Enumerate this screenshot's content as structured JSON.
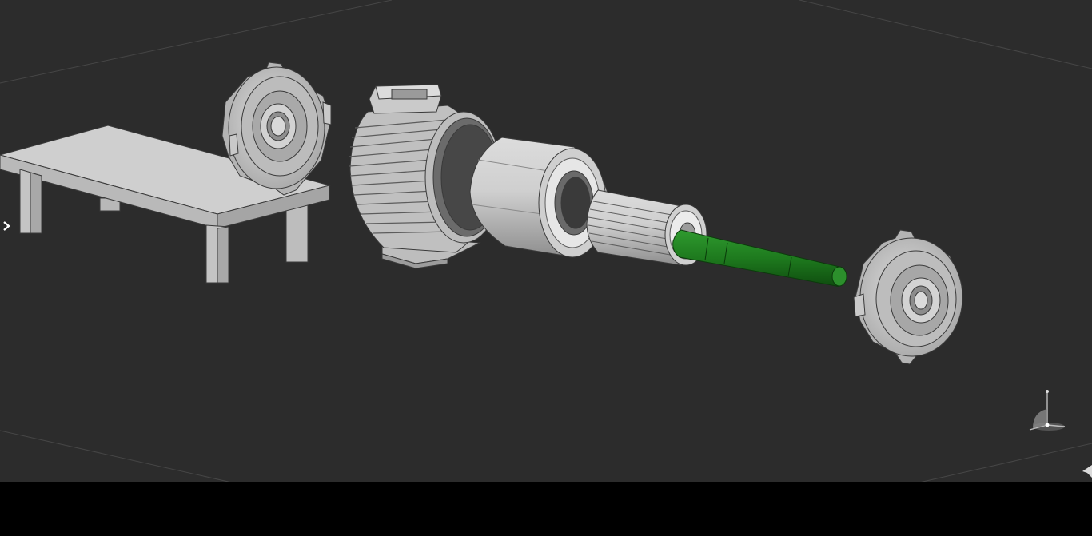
{
  "viewport": {
    "background": "#2c2c2c",
    "grid_line_color": "#4a4a4a"
  },
  "scene": {
    "objects": [
      {
        "name": "workbench-table",
        "color": "#d0d0d0"
      },
      {
        "name": "rear-end-shield",
        "color": "#c8c8c8"
      },
      {
        "name": "motor-housing-frame",
        "color": "#c4c4c4"
      },
      {
        "name": "stator-core",
        "color": "#c8c8c8"
      },
      {
        "name": "rotor-core",
        "color": "#cfcfcf"
      },
      {
        "name": "rotor-shaft",
        "color": "#1f7a1f",
        "selected": true
      },
      {
        "name": "front-end-shield",
        "color": "#c8c8c8"
      }
    ]
  },
  "icons": {
    "panel_expand": "chevron-right-icon",
    "view_gizmo": "axis-triad-icon",
    "corner_handle": "resize-handle-icon"
  },
  "bottom_bar": {
    "background": "#000000"
  }
}
